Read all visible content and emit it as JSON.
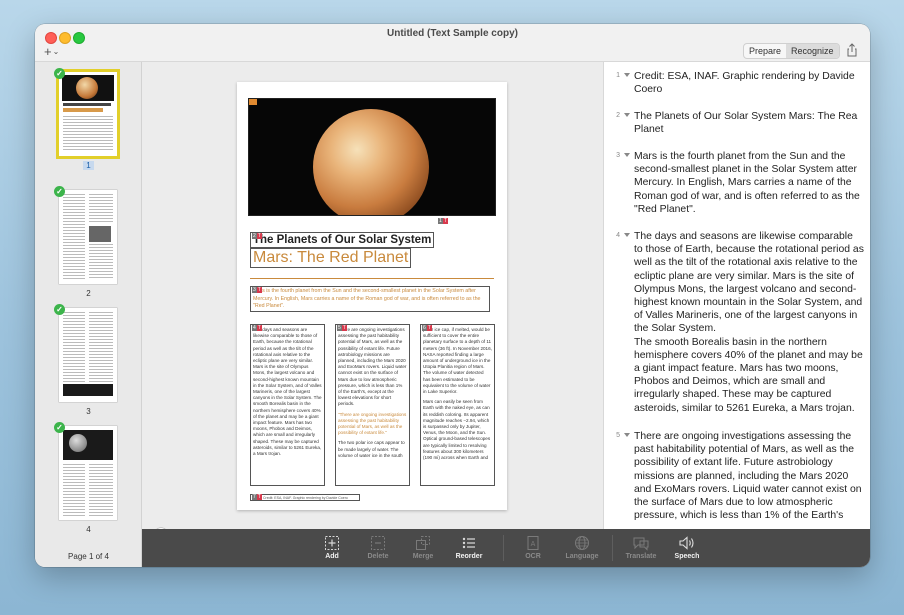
{
  "window": {
    "title": "Untitled (Text Sample copy)",
    "add_label": "+",
    "mode_tabs": [
      "Prepare",
      "Recognize"
    ],
    "active_mode": "Recognize"
  },
  "sidebar": {
    "thumbnails": [
      {
        "label": "1",
        "selected": true
      },
      {
        "label": "2",
        "selected": false
      },
      {
        "label": "3",
        "selected": false
      },
      {
        "label": "4",
        "selected": false
      }
    ],
    "page_count": "Page 1 of 4"
  },
  "document": {
    "title": "The Planets of Our Solar System",
    "subtitle": "Mars: The Red Planet",
    "lead": "Mars is the fourth planet from the Sun and the second-smallest planet in the Solar System after Mercury. In English, Mars carries a name of the Roman god of war, and is often referred to as the \"Red Planet\".",
    "col1": "The days and seasons are likewise comparable to those of Earth, because the rotational period as well as the tilt of the rotational axis relative to the ecliptic plane are very similar. Mars is the site of Olympus Mons, the largest volcano and second-highest known mountain in the Solar System, and of Valles Marineris, one of the largest canyons in the Solar System. The smooth Borealis basin in the northern hemisphere covers 40% of the planet and may be a giant impact feature. Mars has two moons, Phobos and Deimos, which are small and irregularly shaped. These may be captured asteroids, similar to 5261 Eureka, a Mars trojan.",
    "col2a": "There are ongoing investigations assessing the past habitability potential of Mars, as well as the possibility of extant life. Future astrobiology missions are planned, including the Mars 2020 and ExoMars rovers. Liquid water cannot exist on the surface of Mars due to low atmospheric pressure, which is less than 1% of the Earth's, except at the lowest elevations for short periods.",
    "col2b": "\"There are ongoing investigations assessing the past habitability potential of Mars, as well as the possibility of extant life.\"",
    "col2c": "The two polar ice caps appear to be made largely of water. The volume of water ice in the south",
    "col3a": "polar ice cap, if melted, would be sufficient to cover the entire planetary surface to a depth of 11 meters (36 ft). In November 2016, NASA reported finding a large amount of underground ice in the Utopia Planitia region of Mars. The volume of water detected has been estimated to be equivalent to the volume of water in Lake Superior.",
    "col3b": "Mars can easily be seen from Earth with the naked eye, as can its reddish coloring. Its apparent magnitude reaches −2.94, which is surpassed only by Jupiter, Venus, the Moon, and the Sun. Optical ground-based telescopes are typically limited to resolving features about 300 kilometers (190 mi) across when Earth and",
    "footer": "Credit: ESA, INAF. Graphic rendering by Davide Coero",
    "tags": [
      {
        "n": "1",
        "t": "T"
      },
      {
        "n": "2",
        "t": "T"
      },
      {
        "n": "3",
        "t": "T"
      },
      {
        "n": "4",
        "t": "T"
      },
      {
        "n": "5",
        "t": "T"
      },
      {
        "n": "6",
        "t": "T"
      },
      {
        "n": "7",
        "t": "T"
      }
    ]
  },
  "text_panel": {
    "paragraphs": [
      {
        "num": "1",
        "text": "Credit: ESA, INAF. Graphic rendering by Davide Coero"
      },
      {
        "num": "2",
        "text": "The Planets of Our Solar System Mars: The Rea Planet"
      },
      {
        "num": "3",
        "text": "Mars is the fourth planet from the Sun and the second-smallest planet in the Solar System atter Mercury. In English, Mars carries a name of the Roman god of war, and is often referred to as the \"Red Planet\"."
      },
      {
        "num": "4",
        "text": "The days and seasons are likewise comparable to those of Earth, because the rotational period as well as the tilt of the rotational axis relative to the ecliptic plane are very similar. Mars is the site of Olympus Mons, the largest volcano and second-highest known mountain in the Solar System, and of Valles Marineris, one of the largest canyons in the Solar System.\nThe smooth Borealis basin in the northern hemisphere covers 40% of the planet and may be a giant impact feature. Mars has two moons, Phobos and Deimos, which are small and irregularly shaped. These may be captured asteroids, similar to 5261 Eureka, a Mars trojan."
      },
      {
        "num": "5",
        "text": "There are ongoing investigations assessing the past habitability potential of Mars, as well as the possibility of extant life. Future astrobiology missions are planned, including the Mars 2020 and ExoMars rovers. Liquid water cannot exist on the surface of Mars due to low atmospheric pressure, which is less than 1% of the Earth's"
      }
    ]
  },
  "toolbar": {
    "add": "Add",
    "delete": "Delete",
    "merge": "Merge",
    "reorder": "Reorder",
    "ocr": "OCR",
    "language": "Language",
    "translate": "Translate",
    "speech": "Speech"
  },
  "colors": {
    "accent_selection": "#e2cf2a",
    "check_green": "#3cb44b",
    "tag_red": "#d8394d",
    "subtitle_orange": "#c98a3c",
    "toolbar_bg": "#4a4a4a"
  }
}
